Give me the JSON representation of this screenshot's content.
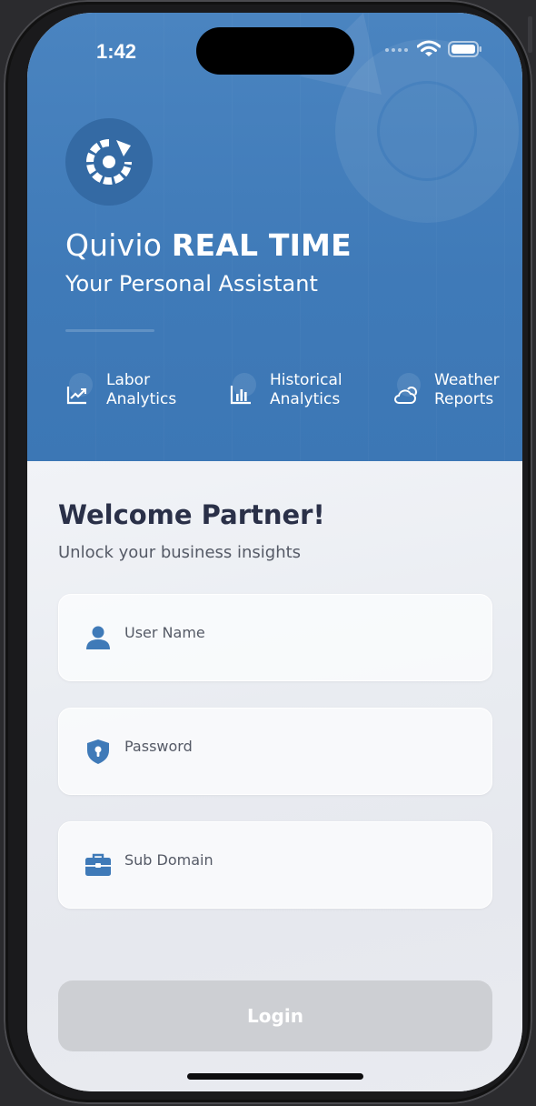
{
  "status_bar": {
    "time": "1:42"
  },
  "hero": {
    "brand_name": "Quivio",
    "brand_emphasis": "REAL TIME",
    "tagline": "Your Personal Assistant",
    "logo_icon": "sync-arrow-icon",
    "features": [
      {
        "label": "Labor Analytics",
        "icon": "trending-chart-icon"
      },
      {
        "label": "Historical Analytics",
        "icon": "bar-chart-icon"
      },
      {
        "label": "Weather Reports",
        "icon": "cloud-sun-icon"
      }
    ]
  },
  "login": {
    "heading": "Welcome Partner!",
    "subheading": "Unlock your business insights",
    "fields": [
      {
        "placeholder": "User Name",
        "icon": "user-icon"
      },
      {
        "placeholder": "Password",
        "icon": "shield-lock-icon"
      },
      {
        "placeholder": "Sub Domain",
        "icon": "briefcase-icon"
      }
    ],
    "submit_label": "Login"
  },
  "colors": {
    "primary": "#3f7ab8",
    "heading": "#2a3048",
    "button_disabled": "#cdcfd3"
  }
}
